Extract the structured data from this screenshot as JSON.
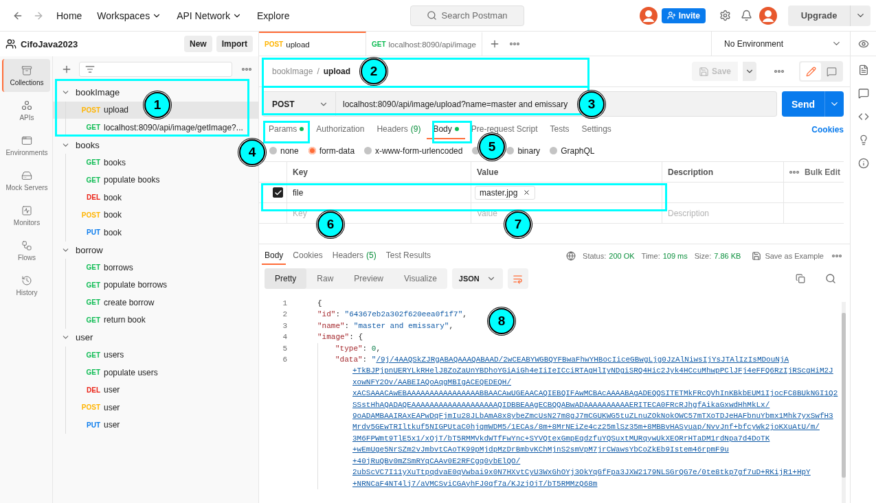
{
  "nav": {
    "items": [
      {
        "label": "Home",
        "dropdown": false
      },
      {
        "label": "Workspaces",
        "dropdown": true
      },
      {
        "label": "API Network",
        "dropdown": true
      },
      {
        "label": "Explore",
        "dropdown": false
      }
    ],
    "search": {
      "placeholder": "Search Postman"
    },
    "invite": "Invite",
    "upgrade": "Upgrade"
  },
  "workspace": {
    "name": "CifoJava2023",
    "buttons": [
      "New",
      "Import"
    ]
  },
  "rail": [
    {
      "label": "Collections",
      "kind": "collections",
      "selected": true
    },
    {
      "label": "APIs",
      "kind": "apis",
      "selected": false
    },
    {
      "label": "Environments",
      "kind": "environments",
      "selected": false
    },
    {
      "label": "Mock Servers",
      "kind": "mocks",
      "selected": false
    },
    {
      "label": "Monitors",
      "kind": "monitors",
      "selected": false
    },
    {
      "label": "Flows",
      "kind": "flows",
      "selected": false
    },
    {
      "label": "History",
      "kind": "history",
      "selected": false
    }
  ],
  "tree": [
    {
      "name": "bookImage",
      "expanded": true,
      "children": [
        {
          "method": "POST",
          "name": "upload",
          "color": "#ffb400",
          "selected": true
        },
        {
          "method": "GET",
          "name": "localhost:8090/api/image/getImage?...",
          "color": "#0cbb52",
          "selected": false
        }
      ]
    },
    {
      "name": "books",
      "expanded": true,
      "children": [
        {
          "method": "GET",
          "name": "books",
          "color": "#0cbb52",
          "selected": false
        },
        {
          "method": "GET",
          "name": "populate books",
          "color": "#0cbb52",
          "selected": false
        },
        {
          "method": "DEL",
          "name": "book",
          "color": "#eb2013",
          "selected": false
        },
        {
          "method": "POST",
          "name": "book",
          "color": "#ffb400",
          "selected": false
        },
        {
          "method": "PUT",
          "name": "book",
          "color": "#097bed",
          "selected": false
        }
      ]
    },
    {
      "name": "borrow",
      "expanded": true,
      "children": [
        {
          "method": "GET",
          "name": "borrows",
          "color": "#0cbb52",
          "selected": false
        },
        {
          "method": "GET",
          "name": "populate borrows",
          "color": "#0cbb52",
          "selected": false
        },
        {
          "method": "GET",
          "name": "create borrow",
          "color": "#0cbb52",
          "selected": false
        },
        {
          "method": "GET",
          "name": "return book",
          "color": "#0cbb52",
          "selected": false
        }
      ]
    },
    {
      "name": "user",
      "expanded": true,
      "children": [
        {
          "method": "GET",
          "name": "users",
          "color": "#0cbb52",
          "selected": false
        },
        {
          "method": "GET",
          "name": "populate users",
          "color": "#0cbb52",
          "selected": false
        },
        {
          "method": "DEL",
          "name": "user",
          "color": "#eb2013",
          "selected": false
        },
        {
          "method": "POST",
          "name": "user",
          "color": "#ffb400",
          "selected": false
        },
        {
          "method": "PUT",
          "name": "user",
          "color": "#097bed",
          "selected": false
        }
      ]
    }
  ],
  "tabs": [
    {
      "method": "POST",
      "label": "upload",
      "color": "#ffb400",
      "selected": true
    },
    {
      "method": "GET",
      "label": "localhost:8090/api/image",
      "color": "#0cbb52",
      "selected": false
    }
  ],
  "environment": "No Environment",
  "breadcrumb": {
    "parent": "bookImage",
    "separator": "/",
    "current": "upload"
  },
  "save": {
    "label": "Save",
    "disabled": true
  },
  "request": {
    "method": "POST",
    "url": "localhost:8090/api/image/upload?name=master and emissary",
    "send": "Send"
  },
  "request_tabs": [
    {
      "label": "Params",
      "dot": true,
      "selected": false
    },
    {
      "label": "Authorization",
      "dot": false,
      "selected": false
    },
    {
      "label": "Headers",
      "count": "(9)",
      "dot": false,
      "selected": false
    },
    {
      "label": "Body",
      "dot": true,
      "selected": true
    },
    {
      "label": "Pre-request Script",
      "dot": false,
      "selected": false
    },
    {
      "label": "Tests",
      "dot": false,
      "selected": false
    },
    {
      "label": "Settings",
      "dot": false,
      "selected": false
    }
  ],
  "cookies": "Cookies",
  "body_types": [
    {
      "label": "none",
      "selected": false
    },
    {
      "label": "form-data",
      "selected": true
    },
    {
      "label": "x-www-form-urlencoded",
      "selected": false
    },
    {
      "selected": false
    },
    {
      "label": "binary",
      "selected": false
    },
    {
      "label": "GraphQL",
      "selected": false
    }
  ],
  "params_table": {
    "columns": [
      "Key",
      "Value",
      "Description"
    ],
    "bulk_edit": "Bulk Edit",
    "rows": [
      {
        "checked": true,
        "key": "file",
        "file": "master.jpg"
      }
    ],
    "placeholders": {
      "key": "Key",
      "value": "Value",
      "description": "Description"
    }
  },
  "response": {
    "tabs": [
      {
        "label": "Body",
        "selected": true
      },
      {
        "label": "Cookies",
        "selected": false
      },
      {
        "label": "Headers",
        "count": "(5)",
        "selected": false
      },
      {
        "label": "Test Results",
        "selected": false
      }
    ],
    "status": [
      {
        "label": "Status:",
        "value": "200 OK"
      },
      {
        "label": "Time:",
        "value": "109 ms"
      },
      {
        "label": "Size:",
        "value": "7.86 KB"
      }
    ],
    "save_example": "Save as Example",
    "views": [
      {
        "label": "Pretty",
        "selected": true
      },
      {
        "label": "Raw",
        "selected": false
      },
      {
        "label": "Preview",
        "selected": false
      },
      {
        "label": "Visualize",
        "selected": false
      }
    ],
    "format": "JSON",
    "lines": [
      {
        "number": "1",
        "segments": [
          {
            "kind": "punct",
            "text": "{"
          }
        ],
        "children": [
          {
            "number": "2",
            "segments": [
              {
                "kind": "key",
                "text": "\"id\""
              },
              {
                "kind": "punct",
                "text": ": "
              },
              {
                "kind": "string",
                "text": "\"64367eb2a302f620eea0f1f7\""
              },
              {
                "kind": "punct",
                "text": ","
              }
            ]
          },
          {
            "number": "3",
            "segments": [
              {
                "kind": "key",
                "text": "\"name\""
              },
              {
                "kind": "punct",
                "text": ": "
              },
              {
                "kind": "string",
                "text": "\"master and emissary\""
              },
              {
                "kind": "punct",
                "text": ","
              }
            ]
          },
          {
            "number": "4",
            "segments": [
              {
                "kind": "key",
                "text": "\"image\""
              },
              {
                "kind": "punct",
                "text": ": {"
              }
            ],
            "children": [
              {
                "number": "5",
                "segments": [
                  {
                    "kind": "key",
                    "text": "\"type\""
                  },
                  {
                    "kind": "punct",
                    "text": ": "
                  },
                  {
                    "kind": "number",
                    "text": "0"
                  },
                  {
                    "kind": "punct",
                    "text": ","
                  }
                ]
              },
              {
                "number": "6",
                "segments": [
                  {
                    "kind": "key",
                    "text": "\"data\""
                  },
                  {
                    "kind": "punct",
                    "text": ": "
                  },
                  {
                    "kind": "string",
                    "text": "\""
                  },
                  {
                    "kind": "link",
                    "text": "/9j/4AAQSkZJRgABAQAAAQABAAD/2wCEABYWGBQYFBwaFhwYHBocIiceGBwgLjg0JzAlNiwsIjYsJTAlIzIsMDouNjA"
                  }
                ],
                "wrapped": [
                  "+TkBJPjpnUERYLkRHelJ8ZoZaUnYBDhoYGiAiGh4eIiIeICciRTAgHlIyNDgiSRQ4Hic2Jyk4HCcuMhwpPClJFj4eFFQ6RzIjRScgHiM2J",
                  "xowNFY2Ov/AABEIAQoAqgMBIgACEQEDEQH/",
                  "xACSAAACAwEBAAAAAAAAAAAAAAAABBAACAwUGEAACAQIEBQIFAwMCBAcAAAABAgADEQQSITETMkFRcQVhInKBkbEUM1IjocFC8BUkNGI1Q2",
                  "SSstHhAQADAQEAAAAAAAAAAAAAAAAAAAQIDBBEAAgECBQQABwADAAAAAAAAAAERITECA0FRcRJhgfAikaGxwdHhMkLx/",
                  "9oADAMBAAIRAxEAPwDqFjmIu28JLbAmA8x8ybeZmcUsN27m8gJ7mCGUKWG5tuZLnuZOkNokOWC57mTXoTDJeHAFbnuYbmx1Mhk7yxSwfH3",
                  "Mrdv5GEwTRIltkuf5NIGPUtaC0hjgmWDM5/1ECAs/8m+8MrNEiZe4cz25mlSz35m+8MBBvHASyuap/NvvJnf+bfcyWk2joKXuAtU/m/",
                  "3M6FPWmt9TlE5x1/xOjT/bT5RMMVkdWTfFwYnc+SYVQtexGmpEqdzfuYQSuxtMURqywUkXEORrHTaDM1rdNpa7d4DoTK",
                  "+wEmUge5NrSZm2vJmbvtCAoTK99pMjdpMzDrBmbvKChMjnS2smVpM7jrCWawsYbCoZkEb9Istem46rpmF9u",
                  "+40jRuQBv0mZSmRYqCAAv0E2RFCgq0ybElQO/",
                  "2ubScVC7I11yXuTtpqdvaE0qVwbai9x0N7HXvtCyU3WxGhOYj3OkYqGfFpa3JXW2179NLSGrQG7e/0te8tkp7gf7uD+RKijR1+HpY",
                  "+NRNCaF4NT4lj7/aVMCSviCGAyhFJ0qf7a/KJzjOjT/bT5RMMzQ68m"
                ]
              }
            ]
          }
        ]
      }
    ]
  },
  "annotations": [
    "1",
    "2",
    "3",
    "4",
    "5",
    "6",
    "7",
    "8"
  ]
}
